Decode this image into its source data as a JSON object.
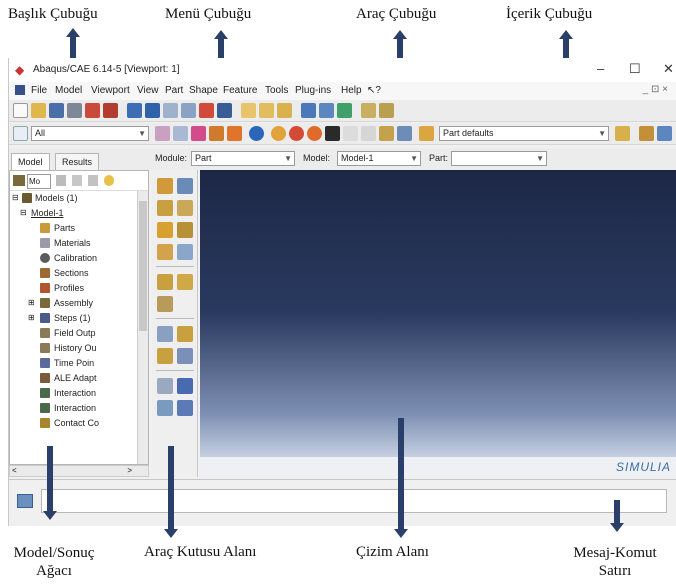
{
  "callouts": {
    "title_bar": "Başlık Çubuğu",
    "menu_bar": "Menü Çubuğu",
    "toolbar": "Araç Çubuğu",
    "context_bar": "İçerik Çubuğu",
    "model_tree_line1": "Model/Sonuç",
    "model_tree_line2": "Ağacı",
    "toolbox": "Araç Kutusu Alanı",
    "drawing_area": "Çizim Alanı",
    "message_line1": "Mesaj-Komut",
    "message_line2": "Satırı"
  },
  "window": {
    "title": "Abaqus/CAE 6.14-5 [Viewport: 1]",
    "minimize": "–",
    "maximize": "☐",
    "close": "✕"
  },
  "menu": {
    "items": [
      "File",
      "Model",
      "Viewport",
      "View",
      "Part",
      "Shape",
      "Feature",
      "Tools",
      "Plug-ins",
      "Help",
      "↖?"
    ],
    "corner": "_ ⊡ ×"
  },
  "toolbar2": {
    "select_value": "All",
    "part_defaults": "Part defaults"
  },
  "context": {
    "module_label": "Module:",
    "module_value": "Part",
    "model_label": "Model:",
    "model_value": "Model-1",
    "part_label": "Part:",
    "part_value": ""
  },
  "tabs": {
    "model": "Model",
    "results": "Results"
  },
  "tree": {
    "tools_select": "Mo",
    "items": [
      "Models (1)",
      "Model-1",
      "Parts",
      "Materials",
      "Calibration",
      "Sections",
      "Profiles",
      "Assembly",
      "Steps (1)",
      "Field Outp",
      "History Ou",
      "Time Poin",
      "ALE Adapt",
      "Interaction",
      "Interaction",
      "Contact Co"
    ]
  },
  "logo": "SIMULIA",
  "colors": {
    "accent": "#2b3f6b",
    "viewport_top": "#1c2745",
    "viewport_bottom": "#c6d0e2"
  }
}
